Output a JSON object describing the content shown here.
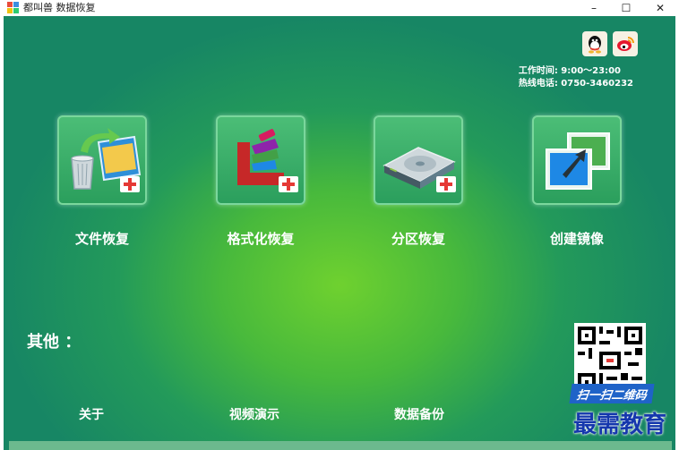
{
  "window": {
    "title": "都叫兽 数据恢复",
    "min": "–",
    "max": "☐",
    "close": "✕"
  },
  "contact": {
    "hours": "工作时间: 9:00～23:00",
    "hotline": "热线电话: 0750-3460232",
    "icons": [
      "qq-icon",
      "weibo-icon"
    ]
  },
  "features": [
    {
      "label": "文件恢复",
      "icon": "file-recovery-icon"
    },
    {
      "label": "格式化恢复",
      "icon": "format-recovery-icon"
    },
    {
      "label": "分区恢复",
      "icon": "partition-recovery-icon"
    },
    {
      "label": "创建镜像",
      "icon": "create-image-icon"
    }
  ],
  "others": {
    "heading": "其他 ：",
    "links": [
      "关于",
      "视频演示",
      "数据备份"
    ]
  },
  "qr": {
    "banner": "扫一扫二维码"
  },
  "watermark": "最需教育",
  "colors": {
    "accent": "#48b93c",
    "dark": "#178664"
  }
}
